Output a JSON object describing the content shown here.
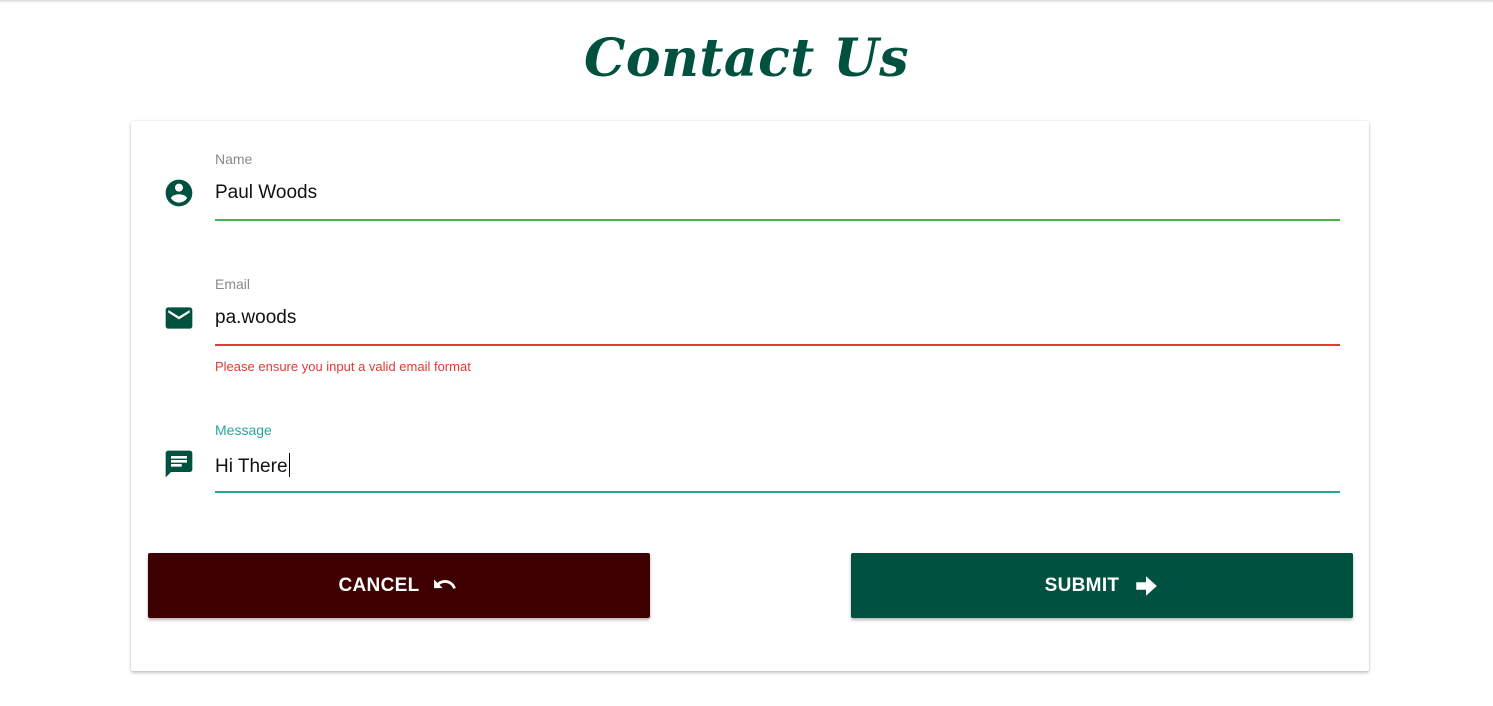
{
  "page": {
    "title": "Contact Us"
  },
  "form": {
    "name": {
      "label": "Name",
      "value": "Paul Woods",
      "icon": "account-circle-icon"
    },
    "email": {
      "label": "Email",
      "value": "pa.woods",
      "icon": "mail-icon",
      "error": "Please ensure you input a valid email format"
    },
    "message": {
      "label": "Message",
      "value": "Hi There",
      "icon": "message-icon"
    }
  },
  "buttons": {
    "cancel": {
      "label": "CANCEL",
      "icon": "undo-icon"
    },
    "submit": {
      "label": "SUBMIT",
      "icon": "arrow-right-icon"
    }
  },
  "colors": {
    "brand_green": "#00513f",
    "valid_line": "#4caf50",
    "error_red": "#e53935",
    "focus_teal": "#26a69a",
    "cancel_bg": "#3e0000"
  }
}
